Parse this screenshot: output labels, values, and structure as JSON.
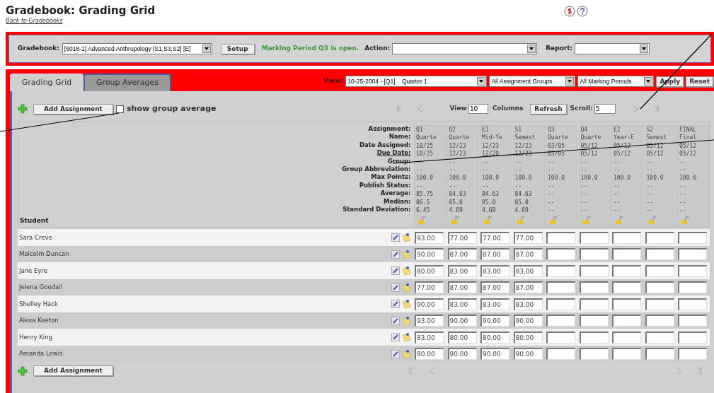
{
  "title": "Gradebook: Grading Grid",
  "back_link": "Back to Gradebooks",
  "toolbar": {
    "gradebook_label": "Gradebook:",
    "gradebook_value": "[6018-1] Advanced Anthropology [S1,S3,S2] [E]",
    "setup_button": "Setup",
    "status_message": "Marking Period Q3 is open.",
    "action_label": "Action:",
    "report_label": "Report:"
  },
  "tabs": [
    {
      "label": "Grading Grid",
      "selected": true
    },
    {
      "label": "Group Averages",
      "selected": false
    }
  ],
  "view_bar": {
    "view_label": "View:",
    "period": "10-25-2004 - [Q1]    Quarter 1",
    "groups": "All Assignment Groups",
    "marking_periods": "All Marking Periods",
    "apply_button": "Apply",
    "reset_button": "Reset"
  },
  "grid_toolbar": {
    "add_button": "Add Assignment",
    "show_group_average": {
      "label": "show group average",
      "checked": false
    },
    "view_label": "View",
    "view_count": "10",
    "columns_label": "Columns",
    "refresh_button": "Refresh",
    "scroll_label": "Scroll:",
    "scroll_value": "5"
  },
  "row_labels": [
    {
      "text": "Assignment:",
      "link": false
    },
    {
      "text": "Name:",
      "link": false
    },
    {
      "text": "Date Assigned:",
      "link": false
    },
    {
      "text": "Due Date:",
      "link": true
    },
    {
      "text": "Group:",
      "link": false
    },
    {
      "text": "Group Abbreviation:",
      "link": false
    },
    {
      "text": "Max Points:",
      "link": false
    },
    {
      "text": "Publish Status:",
      "link": false
    },
    {
      "text": "Average:",
      "link": false
    },
    {
      "text": "Median:",
      "link": false
    },
    {
      "text": "Standard Deviation:",
      "link": false
    }
  ],
  "student_heading": "Student",
  "columns": [
    {
      "values": [
        "Q1",
        "Quarte",
        "10/25",
        "10/25",
        "--",
        "--",
        "100.0",
        "--",
        "85.75",
        "86.5",
        "6.45"
      ]
    },
    {
      "values": [
        "Q2",
        "Quarte",
        "12/23",
        "12/23",
        "--",
        "--",
        "100.0",
        "--",
        "84.63",
        "85.0",
        "4.69"
      ]
    },
    {
      "values": [
        "E1",
        "Mid-Ye",
        "12/23",
        "12/20",
        "--",
        "--",
        "100.0",
        "--",
        "84.63",
        "85.0",
        "4.69"
      ]
    },
    {
      "values": [
        "S1",
        "Semest",
        "12/23",
        "12/23",
        "--",
        "--",
        "100.0",
        "--",
        "84.63",
        "85.0",
        "4.69"
      ]
    },
    {
      "values": [
        "Q3",
        "Quarte",
        "03/05",
        "03/05",
        "--",
        "--",
        "100.0",
        "--",
        "--",
        "--",
        "--"
      ]
    },
    {
      "values": [
        "Q4",
        "Quarte",
        "05/12",
        "05/12",
        "--",
        "--",
        "100.0",
        "--",
        "--",
        "--",
        "--"
      ]
    },
    {
      "values": [
        "E2",
        "Year-E",
        "05/12",
        "05/12",
        "--",
        "--",
        "100.0",
        "--",
        "--",
        "--",
        "--"
      ]
    },
    {
      "values": [
        "S2",
        "Semest",
        "05/12",
        "05/12",
        "--",
        "--",
        "100.0",
        "--",
        "--",
        "--",
        "--"
      ]
    },
    {
      "values": [
        "FINAL",
        "Final",
        "05/12",
        "05/12",
        "--",
        "--",
        "100.0",
        "--",
        "--",
        "--",
        "--"
      ]
    }
  ],
  "students": [
    {
      "name": "Sara Creve",
      "scores": [
        "93.00",
        "77.00",
        "77.00",
        "77.00"
      ]
    },
    {
      "name": "Malcolm Duncan",
      "scores": [
        "90.00",
        "87.00",
        "87.00",
        "87.00"
      ]
    },
    {
      "name": "Jane Eyre",
      "scores": [
        "80.00",
        "83.00",
        "83.00",
        "83.00"
      ]
    },
    {
      "name": "Jelena Goodall",
      "scores": [
        "77.00",
        "87.00",
        "87.00",
        "87.00"
      ]
    },
    {
      "name": "Shelley Hack",
      "scores": [
        "90.00",
        "83.00",
        "83.00",
        "83.00"
      ]
    },
    {
      "name": "Alexa Keeton",
      "scores": [
        "93.00",
        "90.00",
        "90.00",
        "90.00"
      ]
    },
    {
      "name": "Henry King",
      "scores": [
        "83.00",
        "80.00",
        "80.00",
        "80.00"
      ]
    },
    {
      "name": "Amanda Lewis",
      "scores": [
        "80.00",
        "90.00",
        "90.00",
        "90.00"
      ]
    }
  ],
  "bottom_add_button": "Add Assignment"
}
